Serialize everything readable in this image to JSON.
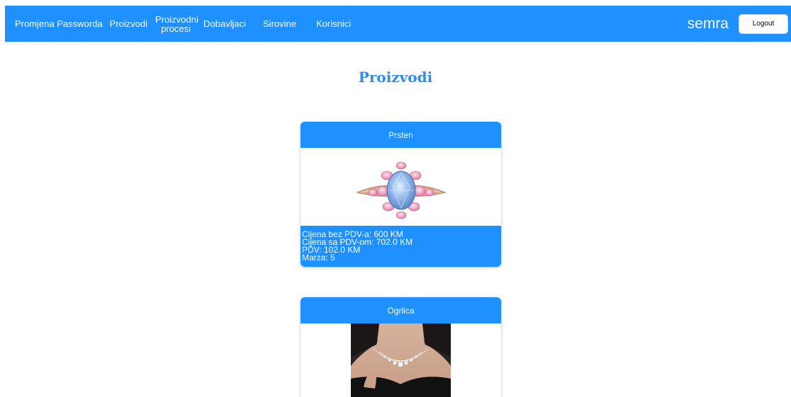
{
  "nav": {
    "items": [
      {
        "label": "Promjena Passworda"
      },
      {
        "label": "Proizvodi"
      },
      {
        "label": "Proizvodni procesi"
      },
      {
        "label": "Dobavljaci"
      },
      {
        "label": "Sirovine"
      },
      {
        "label": "Korisnici"
      }
    ],
    "username": "semra",
    "logout_label": "Logout"
  },
  "page": {
    "title": "Proizvodi"
  },
  "products": [
    {
      "name": "Prsten",
      "image_icon": "ring-image",
      "price_no_vat": "Cijena bez PDV-a: 600 KM",
      "price_with_vat": "Cijena sa PDV-om: 702.0 KM",
      "vat": "PDV: 102.0 KM",
      "margin": "Marza: 5"
    },
    {
      "name": "Ogrlica",
      "image_icon": "necklace-image"
    }
  ],
  "colors": {
    "primary": "#1e90ff",
    "title": "#2a8ef2"
  }
}
